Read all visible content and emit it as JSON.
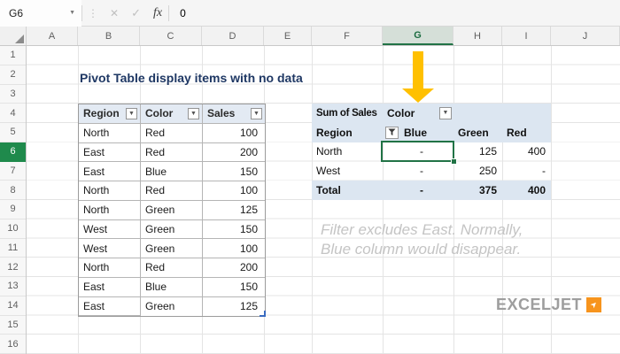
{
  "formula_bar": {
    "name_box": "G6",
    "fx_label": "fx",
    "formula": "0"
  },
  "icons": {
    "dropdown": "▼",
    "caret": "▼",
    "cancel": "✕",
    "confirm": "✓",
    "dots": "⋮",
    "logo_arrow": "➤"
  },
  "sheet": {
    "column_headers": [
      "A",
      "B",
      "C",
      "D",
      "E",
      "F",
      "G",
      "H",
      "I",
      "J"
    ],
    "row_headers": [
      "1",
      "2",
      "3",
      "4",
      "5",
      "6",
      "7",
      "8",
      "9",
      "10",
      "11",
      "12",
      "13",
      "14",
      "15",
      "16"
    ],
    "selected_cell": "G6"
  },
  "title": "Pivot Table display items with no data",
  "data_table": {
    "headers": [
      "Region",
      "Color",
      "Sales"
    ],
    "rows": [
      {
        "region": "North",
        "color": "Red",
        "sales": "100"
      },
      {
        "region": "East",
        "color": "Red",
        "sales": "200"
      },
      {
        "region": "East",
        "color": "Blue",
        "sales": "150"
      },
      {
        "region": "North",
        "color": "Red",
        "sales": "100"
      },
      {
        "region": "North",
        "color": "Green",
        "sales": "125"
      },
      {
        "region": "West",
        "color": "Green",
        "sales": "150"
      },
      {
        "region": "West",
        "color": "Green",
        "sales": "100"
      },
      {
        "region": "North",
        "color": "Red",
        "sales": "200"
      },
      {
        "region": "East",
        "color": "Blue",
        "sales": "150"
      },
      {
        "region": "East",
        "color": "Green",
        "sales": "125"
      }
    ]
  },
  "pivot": {
    "measure_label": "Sum of Sales",
    "column_field": "Color",
    "row_field": "Region",
    "column_items": [
      "Blue",
      "Green",
      "Red"
    ],
    "rows": [
      {
        "label": "North",
        "values": [
          "-",
          "125",
          "400"
        ]
      },
      {
        "label": "West",
        "values": [
          "-",
          "250",
          "-"
        ]
      }
    ],
    "total": {
      "label": "Total",
      "values": [
        "-",
        "375",
        "400"
      ]
    }
  },
  "annotation": {
    "line1": "Filter excludes East. Normally,",
    "line2": "Blue column would disappear."
  },
  "logo": {
    "text": "EXCELJET"
  },
  "colors": {
    "selection_green": "#217346",
    "row_header_green": "#1f8a4c",
    "arrow_yellow": "#FFC000",
    "pivot_blue": "#DCE6F1",
    "title_navy": "#1F3864",
    "logo_orange": "#F7941D"
  }
}
